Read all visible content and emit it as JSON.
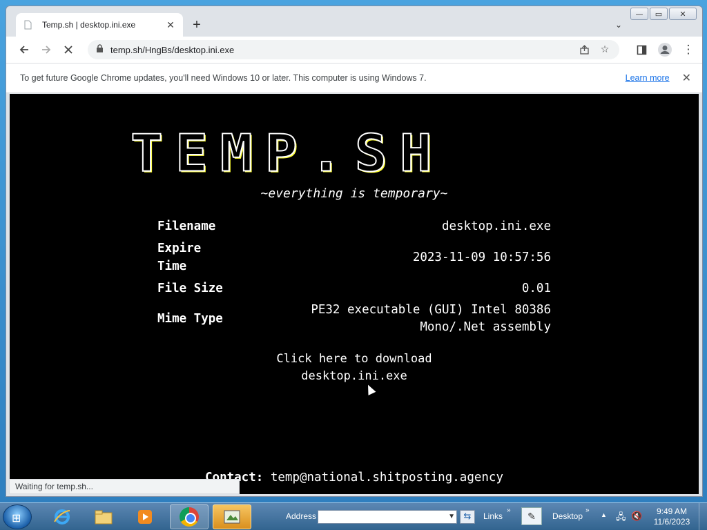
{
  "browser": {
    "tab_title": "Temp.sh | desktop.ini.exe",
    "tab_close": "✕",
    "new_tab": "+",
    "url": "temp.sh/HngBs/desktop.ini.exe",
    "infobar_text": "To get future Google Chrome updates, you'll need Windows 10 or later. This computer is using Windows 7.",
    "learn_more": "Learn more",
    "status": "Waiting for temp.sh..."
  },
  "page": {
    "logo": "TEMP.SH",
    "tagline": "~everything is temporary~",
    "rows": [
      {
        "label": "Filename",
        "value": "desktop.ini.exe"
      },
      {
        "label": "Expire Time",
        "value": "2023-11-09 10:57:56"
      },
      {
        "label": "File Size",
        "value": "0.01"
      },
      {
        "label": "Mime Type",
        "value": "PE32 executable (GUI) Intel 80386 Mono/.Net assembly"
      }
    ],
    "download_line1": "Click here to download",
    "download_line2": "desktop.ini.exe",
    "contact_label": "Contact:",
    "contact_value": "temp@national.shitposting.agency"
  },
  "taskbar": {
    "address_label": "Address",
    "links_label": "Links",
    "desktop_label": "Desktop",
    "time": "9:49 AM",
    "date": "11/6/2023"
  },
  "icons": {
    "back": "back-arrow-icon",
    "forward": "forward-arrow-icon",
    "reload": "stop-loading-icon",
    "lock": "lock-icon"
  }
}
